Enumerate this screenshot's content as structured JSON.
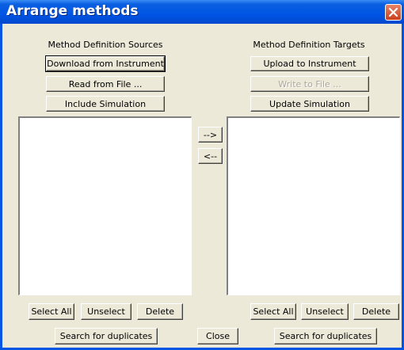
{
  "window": {
    "title": "Arrange methods"
  },
  "sources": {
    "heading": "Method Definition Sources",
    "download_label": "Download from Instrument",
    "read_label": "Read from File ...",
    "include_label": "Include Simulation",
    "select_all_label": "Select All",
    "unselect_label": "Unselect",
    "delete_label": "Delete",
    "search_label": "Search for duplicates"
  },
  "targets": {
    "heading": "Method Definition Targets",
    "upload_label": "Upload to Instrument",
    "write_label": "Write to File ...",
    "update_label": "Update Simulation",
    "select_all_label": "Select All",
    "unselect_label": "Unselect",
    "delete_label": "Delete",
    "search_label": "Search for duplicates"
  },
  "transfer": {
    "to_target_label": "-->",
    "to_source_label": "<--"
  },
  "footer": {
    "close_label": "Close"
  },
  "colors": {
    "titlebar": "#0055e5",
    "dialog_bg": "#ece9d8",
    "close_button": "#c9401e"
  },
  "icons": {
    "close": "close-x-icon"
  }
}
